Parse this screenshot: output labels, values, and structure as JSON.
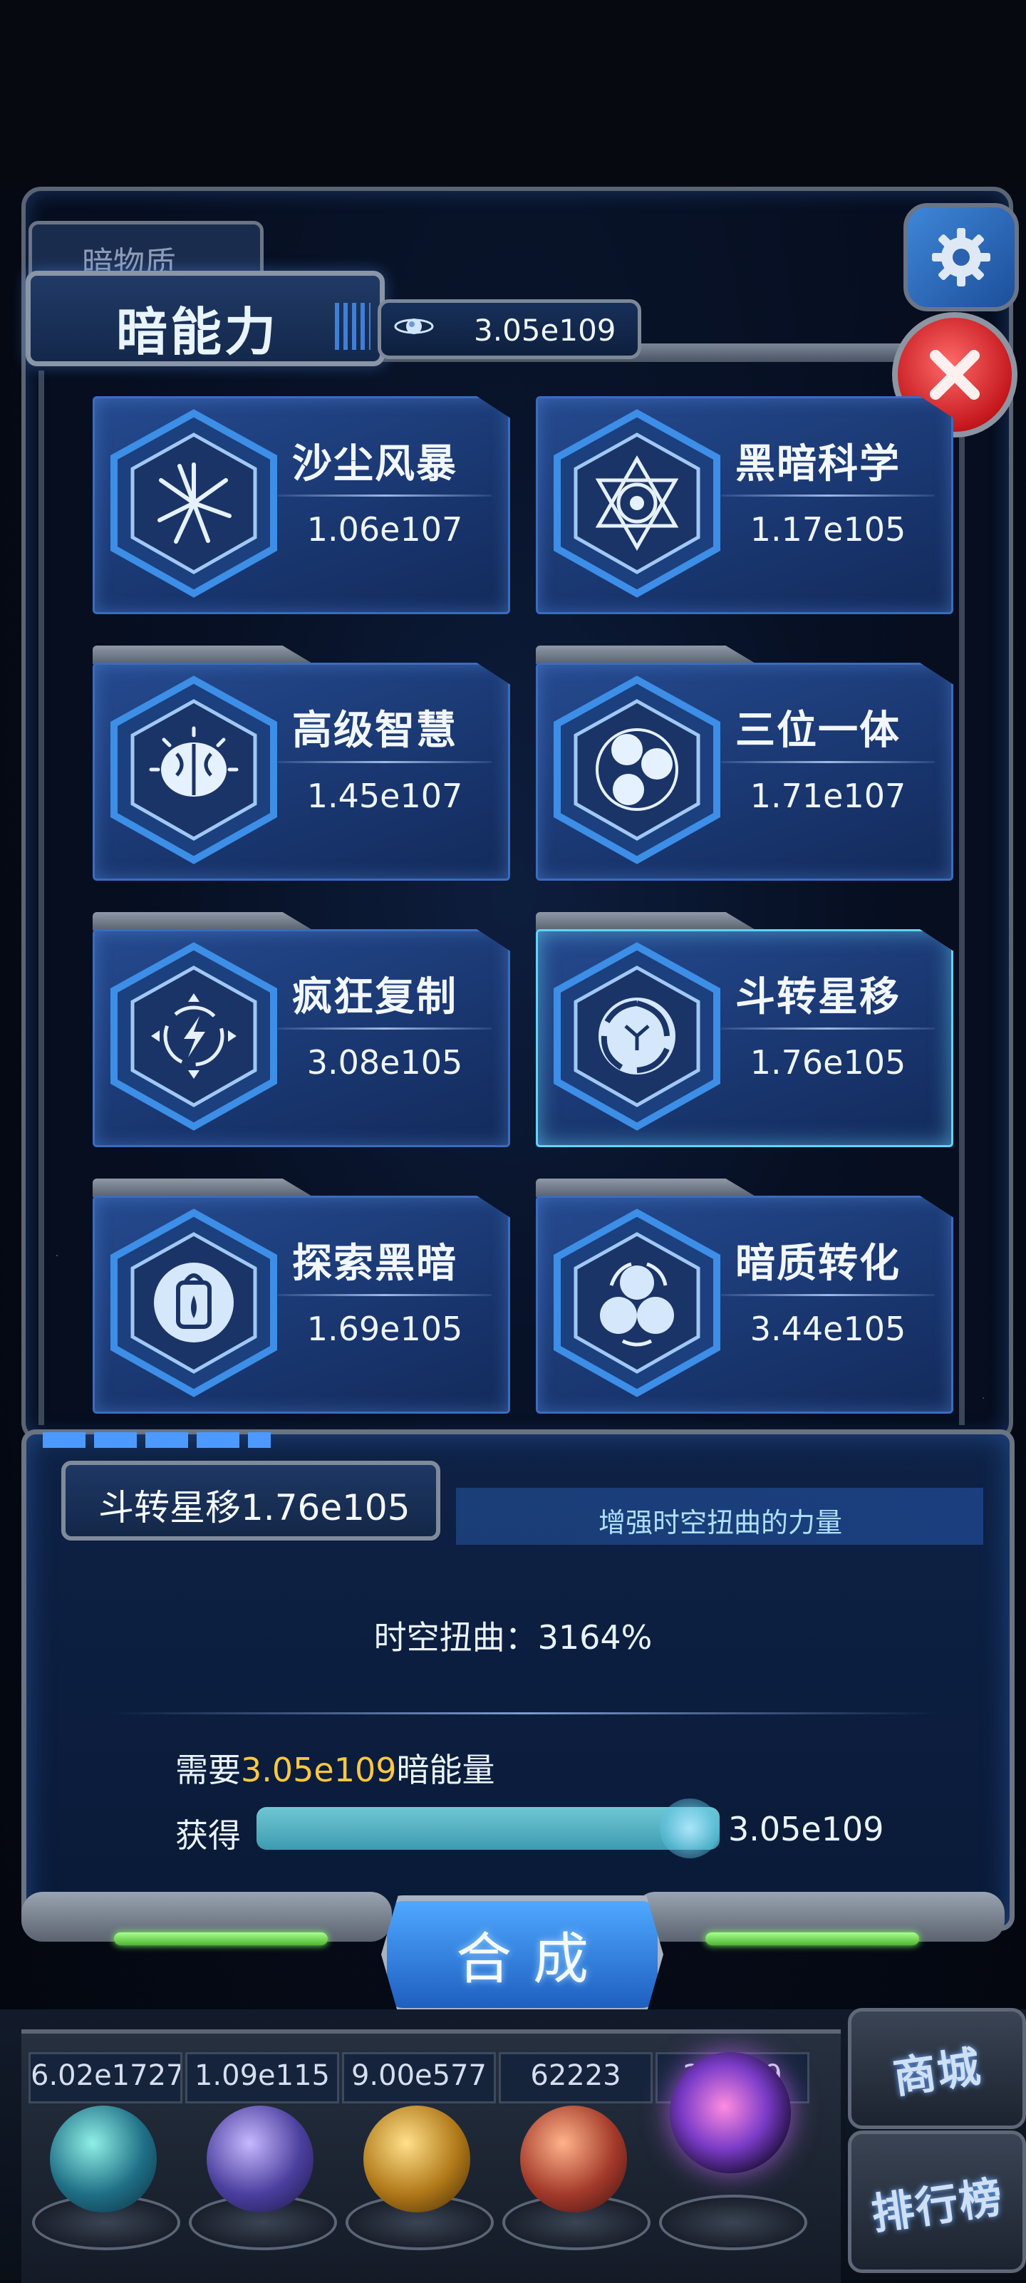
{
  "header": {
    "back_tab_label": "暗物质",
    "main_tab_label": "暗能力",
    "energy_amount": "3.05e109"
  },
  "skills": [
    {
      "name": "沙尘风暴",
      "value": "1.06e107",
      "icon": "dust-storm-icon"
    },
    {
      "name": "黑暗科学",
      "value": "1.17e105",
      "icon": "dark-science-icon"
    },
    {
      "name": "高级智慧",
      "value": "1.45e107",
      "icon": "brain-icon"
    },
    {
      "name": "三位一体",
      "value": "1.71e107",
      "icon": "trinity-icon"
    },
    {
      "name": "疯狂复制",
      "value": "3.08e105",
      "icon": "lightning-icon"
    },
    {
      "name": "斗转星移",
      "value": "1.76e105",
      "icon": "vortex-icon",
      "selected": true
    },
    {
      "name": "探索黑暗",
      "value": "1.69e105",
      "icon": "lantern-icon"
    },
    {
      "name": "暗质转化",
      "value": "3.44e105",
      "icon": "cycle-icon"
    }
  ],
  "detail": {
    "title": "斗转星移1.76e105",
    "description": "增强时空扭曲的力量",
    "effect": "时空扭曲：3164%",
    "need_prefix": "需要",
    "need_amount": "3.05e109",
    "need_suffix": "暗能量",
    "gain_label": "获得",
    "gain_value": "3.05e109",
    "slider_fill": 1.0
  },
  "combine_label": "合成",
  "resources": [
    {
      "value": "6.02e1727",
      "orb": "molecule-orb"
    },
    {
      "value": "1.09e115",
      "orb": "lightning-orb"
    },
    {
      "value": "9.00e577",
      "orb": "galaxy-orb"
    },
    {
      "value": "62223",
      "orb": "cell-orb"
    },
    {
      "value": "2.60e9",
      "orb": "vortex-orb"
    }
  ],
  "side_buttons": {
    "shop": "商城",
    "ranking": "排行榜"
  },
  "colors": {
    "accent": "#3f86d8",
    "highlight": "#ffc83d",
    "slider": "#4fb0c2",
    "close": "#c4181d"
  }
}
